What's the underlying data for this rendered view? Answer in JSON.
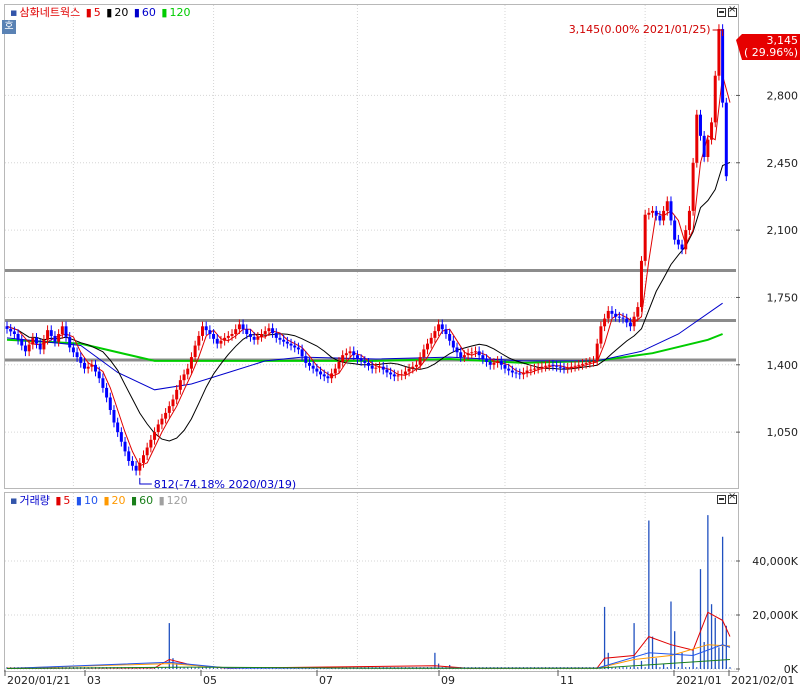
{
  "price_legend": {
    "stock_name": "삼화네트웍스",
    "ma": [
      {
        "label": "5",
        "color": "#e00000"
      },
      {
        "label": "20",
        "color": "#000000"
      },
      {
        "label": "60",
        "color": "#0000cc"
      },
      {
        "label": "120",
        "color": "#00cc00"
      }
    ],
    "badge": "호"
  },
  "volume_legend": {
    "title": "거래량",
    "ma": [
      {
        "label": "5",
        "color": "#e00000"
      },
      {
        "label": "10",
        "color": "#2255ee"
      },
      {
        "label": "20",
        "color": "#ff9900"
      },
      {
        "label": "60",
        "color": "#1a7f1a"
      },
      {
        "label": "120",
        "color": "#a0a0a0"
      }
    ]
  },
  "colors": {
    "up": "#e60000",
    "down": "#0000ff",
    "ma5": "#e00000",
    "ma20": "#000000",
    "ma60": "#0000cc",
    "ma120": "#00cc00",
    "support": "#8c8c8c"
  },
  "chart_data": [
    {
      "type": "candlestick",
      "panel": "price",
      "y_ticks": [
        "2,800",
        "2,450",
        "2,100",
        "1,750",
        "1,400",
        "1,050"
      ],
      "y_tick_values": [
        2800,
        2450,
        2100,
        1750,
        1400,
        1050
      ],
      "ylim": [
        770,
        3270
      ],
      "current_price_label": "3,145",
      "current_change_label": "( 29.96%)",
      "high_annotation": "3,145(0.00% 2021/01/25)",
      "low_annotation": "812(-74.18% 2020/03/19)",
      "horizontal_lines": [
        1890,
        1630,
        1425
      ],
      "series_points": [
        [
          0,
          1600
        ],
        [
          3,
          1560
        ],
        [
          6,
          1470
        ],
        [
          8,
          1540
        ],
        [
          10,
          1480
        ],
        [
          12,
          1580
        ],
        [
          14,
          1520
        ],
        [
          16,
          1600
        ],
        [
          18,
          1490
        ],
        [
          20,
          1440
        ],
        [
          22,
          1380
        ],
        [
          24,
          1400
        ],
        [
          26,
          1330
        ],
        [
          28,
          1230
        ],
        [
          30,
          1100
        ],
        [
          32,
          1000
        ],
        [
          34,
          900
        ],
        [
          36,
          850
        ],
        [
          38,
          930
        ],
        [
          40,
          1010
        ],
        [
          42,
          1090
        ],
        [
          44,
          1150
        ],
        [
          46,
          1220
        ],
        [
          48,
          1320
        ],
        [
          50,
          1380
        ],
        [
          52,
          1500
        ],
        [
          54,
          1600
        ],
        [
          56,
          1560
        ],
        [
          58,
          1510
        ],
        [
          60,
          1540
        ],
        [
          62,
          1560
        ],
        [
          64,
          1610
        ],
        [
          66,
          1560
        ],
        [
          68,
          1530
        ],
        [
          70,
          1560
        ],
        [
          72,
          1590
        ],
        [
          74,
          1540
        ],
        [
          76,
          1520
        ],
        [
          78,
          1500
        ],
        [
          80,
          1480
        ],
        [
          82,
          1410
        ],
        [
          84,
          1380
        ],
        [
          86,
          1350
        ],
        [
          88,
          1330
        ],
        [
          90,
          1380
        ],
        [
          92,
          1450
        ],
        [
          94,
          1470
        ],
        [
          96,
          1430
        ],
        [
          98,
          1410
        ],
        [
          100,
          1380
        ],
        [
          102,
          1390
        ],
        [
          104,
          1360
        ],
        [
          106,
          1340
        ],
        [
          108,
          1350
        ],
        [
          110,
          1380
        ],
        [
          112,
          1400
        ],
        [
          114,
          1480
        ],
        [
          116,
          1540
        ],
        [
          118,
          1610
        ],
        [
          120,
          1560
        ],
        [
          122,
          1490
        ],
        [
          124,
          1440
        ],
        [
          126,
          1460
        ],
        [
          128,
          1470
        ],
        [
          130,
          1430
        ],
        [
          132,
          1400
        ],
        [
          134,
          1420
        ],
        [
          136,
          1380
        ],
        [
          138,
          1360
        ],
        [
          140,
          1350
        ],
        [
          142,
          1370
        ],
        [
          144,
          1380
        ],
        [
          146,
          1390
        ],
        [
          148,
          1400
        ],
        [
          150,
          1390
        ],
        [
          152,
          1380
        ],
        [
          154,
          1390
        ],
        [
          156,
          1400
        ],
        [
          158,
          1410
        ],
        [
          160,
          1420
        ],
        [
          162,
          1600
        ],
        [
          164,
          1680
        ],
        [
          166,
          1650
        ],
        [
          168,
          1640
        ],
        [
          170,
          1600
        ],
        [
          172,
          1700
        ],
        [
          174,
          2180
        ],
        [
          176,
          2200
        ],
        [
          178,
          2150
        ],
        [
          180,
          2250
        ],
        [
          182,
          2050
        ],
        [
          184,
          2000
        ],
        [
          186,
          2200
        ],
        [
          188,
          2700
        ],
        [
          190,
          2480
        ],
        [
          192,
          2660
        ],
        [
          194,
          3145
        ],
        [
          196,
          2380
        ]
      ],
      "ma120_points": [
        [
          0,
          1530
        ],
        [
          20,
          1510
        ],
        [
          40,
          1420
        ],
        [
          60,
          1420
        ],
        [
          80,
          1420
        ],
        [
          100,
          1420
        ],
        [
          120,
          1430
        ],
        [
          140,
          1410
        ],
        [
          160,
          1420
        ],
        [
          175,
          1460
        ],
        [
          190,
          1530
        ],
        [
          194,
          1560
        ]
      ],
      "ma60_points": [
        [
          0,
          1540
        ],
        [
          20,
          1500
        ],
        [
          30,
          1360
        ],
        [
          40,
          1270
        ],
        [
          50,
          1300
        ],
        [
          60,
          1360
        ],
        [
          70,
          1420
        ],
        [
          80,
          1440
        ],
        [
          100,
          1430
        ],
        [
          120,
          1440
        ],
        [
          140,
          1420
        ],
        [
          160,
          1420
        ],
        [
          172,
          1470
        ],
        [
          182,
          1560
        ],
        [
          194,
          1720
        ]
      ],
      "x_ticks": [
        "2020/01/21",
        "03",
        "05",
        "07",
        "09",
        "11",
        "2021/01",
        "2021/02/01"
      ]
    },
    {
      "type": "bar",
      "panel": "volume",
      "y_ticks": [
        "40,000K",
        "20,000K",
        "0K"
      ],
      "y_tick_values": [
        40000,
        20000,
        0
      ],
      "ylim": [
        0,
        60000
      ],
      "series": [
        {
          "name": "거래량",
          "values": [
            [
              44,
              17000
            ],
            [
              45,
              4000
            ],
            [
              46,
              2000
            ],
            [
              116,
              6000
            ],
            [
              117,
              2000
            ],
            [
              120,
              1500
            ],
            [
              162,
              23000
            ],
            [
              163,
              6000
            ],
            [
              170,
              17000
            ],
            [
              172,
              3000
            ],
            [
              174,
              55000
            ],
            [
              175,
              12000
            ],
            [
              176,
              4000
            ],
            [
              178,
              2000
            ],
            [
              180,
              25000
            ],
            [
              181,
              14000
            ],
            [
              183,
              6000
            ],
            [
              186,
              7000
            ],
            [
              188,
              37000
            ],
            [
              189,
              10000
            ],
            [
              190,
              57000
            ],
            [
              191,
              24000
            ],
            [
              192,
              19000
            ],
            [
              193,
              8000
            ],
            [
              194,
              49000
            ],
            [
              195,
              16000
            ]
          ]
        }
      ]
    }
  ]
}
